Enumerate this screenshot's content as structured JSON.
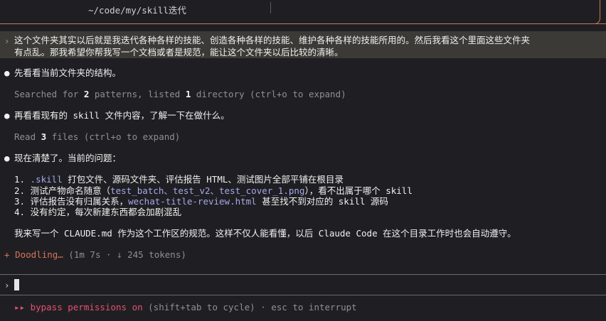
{
  "header": {
    "path": "~/code/my/skill迭代"
  },
  "user_message": {
    "caret": "›",
    "line1": "这个文件夹其实以后就是我迭代各种各样的技能、创造各种各样的技能、维护各种各样的技能所用的。然后我看这个里面这些文件夹",
    "line2": "有点乱。那我希望你帮我写一个文档或者是规范，能让这个文件夹以后比较的清晰。"
  },
  "transcript": {
    "bullet": "●",
    "step1": "先看看当前文件夹的结构。",
    "step1_detail": {
      "pre": "Searched for ",
      "n1": "2",
      "mid": " patterns, listed ",
      "n2": "1",
      "post": " directory (ctrl+o to expand)"
    },
    "step2": "再看看现有的 skill 文件内容，了解一下在做什么。",
    "step2_detail": {
      "pre": "Read ",
      "n1": "3",
      "post": " files (ctrl+o to expand)"
    },
    "step3": "现在清楚了。当前的问题：",
    "issues": [
      {
        "num": "1. ",
        "code": ".skill",
        "rest": " 打包文件、源码文件夹、评估报告 HTML、测试图片全部平铺在根目录"
      },
      {
        "num": "2. ",
        "pre": "测试产物命名随意（",
        "code": "test_batch、test_v2、test_cover_1.png",
        "rest": "），看不出属于哪个 skill"
      },
      {
        "num": "3. ",
        "pre": "评估报告没有归属关系，",
        "code": "wechat-title-review.html",
        "rest": " 甚至找不到对应的 skill 源码"
      },
      {
        "num": "4. ",
        "pre": "没有约定，每次新建东西都会加剧混乱"
      }
    ],
    "conclusion": "我来写一个 CLAUDE.md 作为这个工作区的规范。这样不仅人能看懂，以后 Claude Code 在这个目录工作时也会自动遵守。"
  },
  "status": {
    "spinner": "+",
    "label": "Doodling…",
    "detail": " (1m 7s · ↓ 245 tokens)"
  },
  "input": {
    "caret": "›"
  },
  "footer": {
    "bypass": "▸▸ bypass permissions on",
    "hint": " (shift+tab to cycle) · esc to interrupt"
  },
  "colors": {
    "background": "#1f1f23",
    "accent_border": "#c57b56",
    "user_msg_bg": "#3b3a36",
    "code_text": "#a6a8e8",
    "status": "#d9735b",
    "bypass": "#e8506e"
  }
}
